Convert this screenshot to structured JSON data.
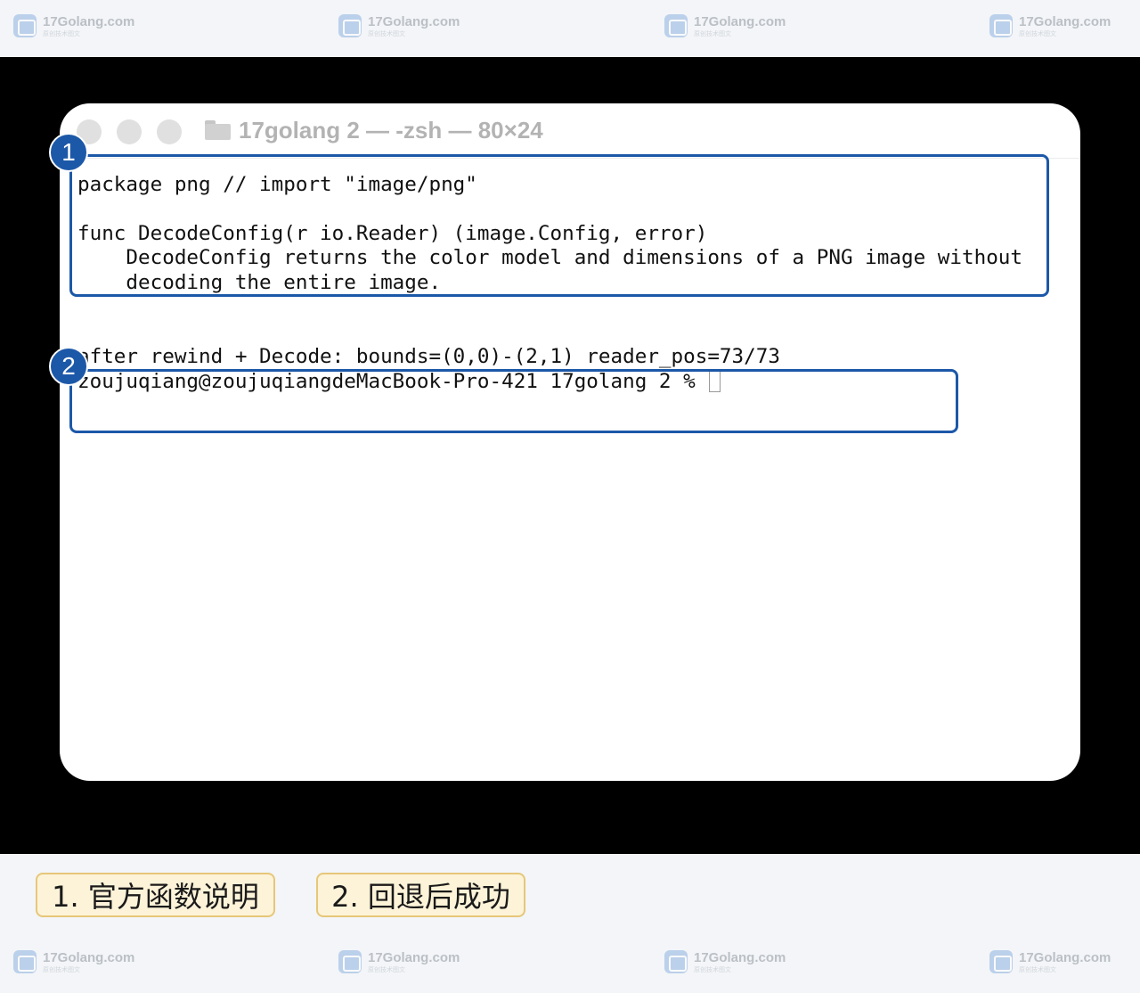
{
  "watermark": {
    "site": "17Golang.com",
    "tagline": "原创技术图文",
    "icon": "17golang-logo-icon",
    "count": 4
  },
  "terminal": {
    "title": "17golang 2 — -zsh — 80×24",
    "icons": {
      "folder": "folder-icon"
    },
    "lines": [
      "package png // import \"image/png\"",
      "",
      "func DecodeConfig(r io.Reader) (image.Config, error)",
      "    DecodeConfig returns the color model and dimensions of a PNG image without",
      "    decoding the entire image.",
      "",
      "",
      "after rewind + Decode: bounds=(0,0)-(2,1) reader_pos=73/73"
    ],
    "prompt": "zoujuqiang@zoujuqiangdeMacBook-Pro-421 17golang 2 % "
  },
  "callouts": [
    {
      "number": "1"
    },
    {
      "number": "2"
    }
  ],
  "captions": [
    "1. 官方函数说明",
    "2. 回退后成功"
  ],
  "colors": {
    "accent_blue": "#1c58a8",
    "caption_bg": "#fdf3d8",
    "caption_border": "#e6c778",
    "stage_bg": "#000000"
  }
}
